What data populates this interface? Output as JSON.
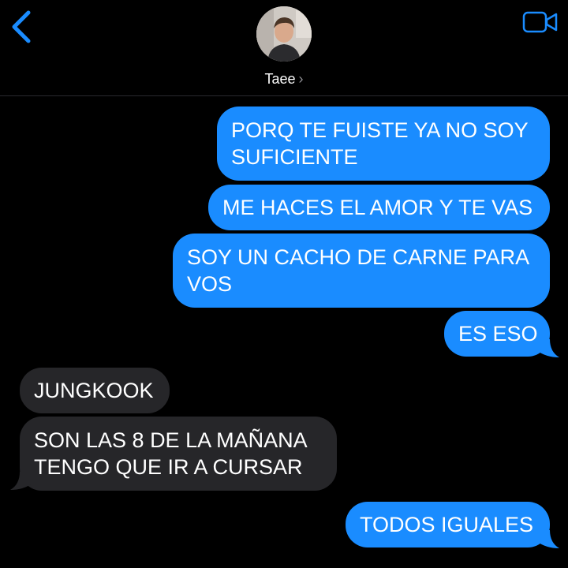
{
  "header": {
    "contact_name": "Taee",
    "chevron": "›",
    "icons": {
      "back": "chevron-left-icon",
      "video": "video-camera-icon",
      "avatar": "contact-avatar-photo"
    },
    "accent_color": "#1a8cff"
  },
  "messages": [
    {
      "direction": "outgoing",
      "lines": [
        "PORQ TE FUISTE YA NO SOY",
        "SUFICIENTE"
      ]
    },
    {
      "direction": "outgoing",
      "lines": [
        "ME HACES EL AMOR Y TE VAS"
      ]
    },
    {
      "direction": "outgoing",
      "lines": [
        "SOY UN CACHO DE CARNE PARA",
        "VOS"
      ]
    },
    {
      "direction": "outgoing",
      "lines": [
        "ES ESO"
      ]
    },
    {
      "direction": "incoming",
      "lines": [
        "JUNGKOOK"
      ]
    },
    {
      "direction": "incoming",
      "lines": [
        "SON LAS 8 DE LA MAÑANA",
        "TENGO QUE IR A CURSAR"
      ]
    },
    {
      "direction": "outgoing",
      "lines": [
        "TODOS IGUALES"
      ]
    }
  ],
  "colors": {
    "outgoing_bubble": "#1a8cff",
    "incoming_bubble": "#262629",
    "background": "#000000"
  }
}
